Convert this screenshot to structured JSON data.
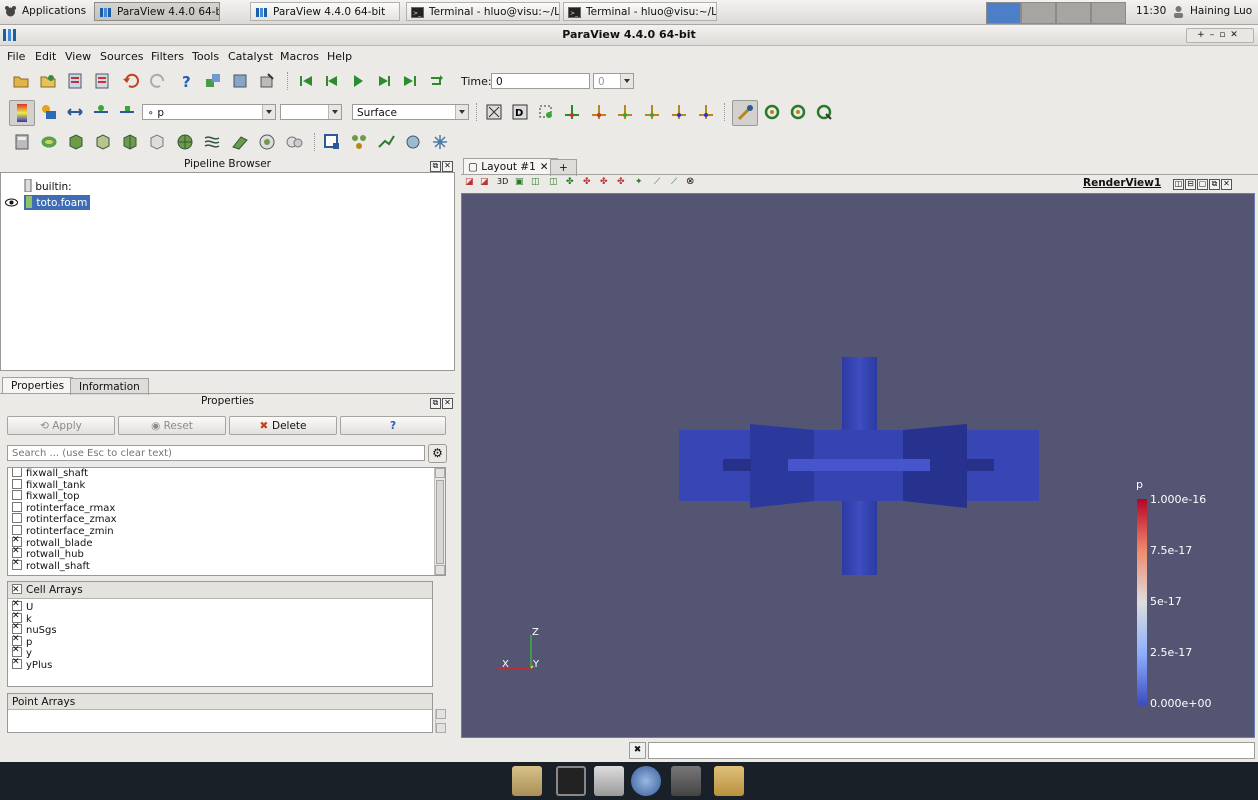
{
  "system_panel": {
    "applications_label": "Applications",
    "tasks": [
      {
        "label": "ParaView 4.4.0 64-bit",
        "active": true
      },
      {
        "label": "ParaView 4.4.0 64-bit",
        "active": false
      },
      {
        "label": "Terminal - hluo@visu:~/L...",
        "active": false
      },
      {
        "label": "Terminal - hluo@visu:~/L...",
        "active": false
      }
    ],
    "clock": "11:30",
    "user": "Haining Luo"
  },
  "window": {
    "title": "ParaView 4.4.0 64-bit"
  },
  "menu": [
    "File",
    "Edit",
    "View",
    "Sources",
    "Filters",
    "Tools",
    "Catalyst",
    "Macros",
    "Help"
  ],
  "toolbar": {
    "time_label": "Time:",
    "time_value": "0",
    "time_index": "0",
    "color_by": "p",
    "component": "",
    "representation": "Surface"
  },
  "pipeline_browser": {
    "title": "Pipeline Browser",
    "items": [
      {
        "label": "builtin:",
        "selected": false
      },
      {
        "label": "toto.foam",
        "selected": true
      }
    ]
  },
  "properties_panel": {
    "tabs": [
      "Properties",
      "Information"
    ],
    "title": "Properties",
    "buttons": {
      "apply": "Apply",
      "reset": "Reset",
      "delete": "Delete",
      "help": "?"
    },
    "search_placeholder": "Search ... (use Esc to clear text)",
    "mesh_regions": [
      {
        "label": "fixwall_shaft",
        "checked": false
      },
      {
        "label": "fixwall_tank",
        "checked": false
      },
      {
        "label": "fixwall_top",
        "checked": false
      },
      {
        "label": "rotinterface_rmax",
        "checked": false
      },
      {
        "label": "rotinterface_zmax",
        "checked": false
      },
      {
        "label": "rotinterface_zmin",
        "checked": false
      },
      {
        "label": "rotwall_blade",
        "checked": true
      },
      {
        "label": "rotwall_hub",
        "checked": true
      },
      {
        "label": "rotwall_shaft",
        "checked": true
      }
    ],
    "cell_arrays_header": "Cell Arrays",
    "cell_arrays": [
      {
        "label": "U",
        "checked": true
      },
      {
        "label": "k",
        "checked": true
      },
      {
        "label": "nuSgs",
        "checked": true
      },
      {
        "label": "p",
        "checked": true
      },
      {
        "label": "y",
        "checked": true
      },
      {
        "label": "yPlus",
        "checked": true
      }
    ],
    "point_arrays_header": "Point Arrays"
  },
  "layout": {
    "tab_label": "Layout #1",
    "add_tab": "+",
    "render_view_label": "RenderView1"
  },
  "color_legend": {
    "title": "p",
    "labels": [
      "1.000e-16",
      "7.5e-17",
      "5e-17",
      "2.5e-17",
      "0.000e+00"
    ],
    "colors": {
      "top": "#b40426",
      "mid": "#dddddd",
      "bottom": "#3b4cc0"
    }
  },
  "orientation_axes": {
    "x": "X",
    "y": "Y",
    "z": "Z"
  },
  "colors": {
    "background": "#535572",
    "geometry": "#3845a8",
    "accent": "#4c7fc7"
  }
}
